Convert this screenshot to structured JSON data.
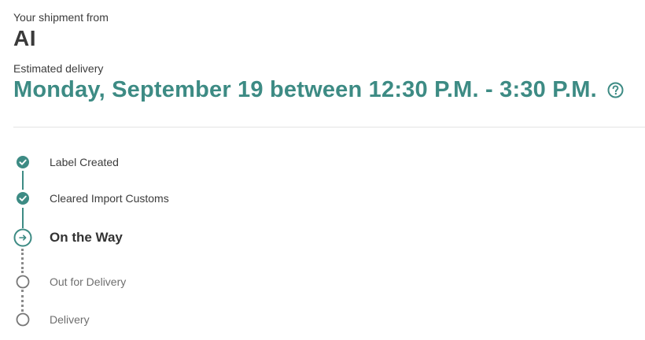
{
  "shipment": {
    "from_label": "Your shipment from",
    "from_name": "AI",
    "eta_label": "Estimated delivery",
    "eta_value": "Monday, September 19 between 12:30 P.M. - 3:30 P.M."
  },
  "colors": {
    "accent": "#3d8b84",
    "text": "#333333",
    "muted": "#6e6e6e",
    "divider": "#e4e4e4",
    "pending_dots": "#8a8a8a"
  },
  "icons": {
    "help": "question-circle-icon",
    "done": "check-circle-icon",
    "current": "arrow-right-circle-icon",
    "pending": "empty-circle-icon"
  },
  "timeline": {
    "steps": [
      {
        "label": "Label Created",
        "status": "done"
      },
      {
        "label": "Cleared Import Customs",
        "status": "done"
      },
      {
        "label": "On the Way",
        "status": "current"
      },
      {
        "label": "Out for Delivery",
        "status": "pending"
      },
      {
        "label": "Delivery",
        "status": "pending"
      }
    ]
  }
}
